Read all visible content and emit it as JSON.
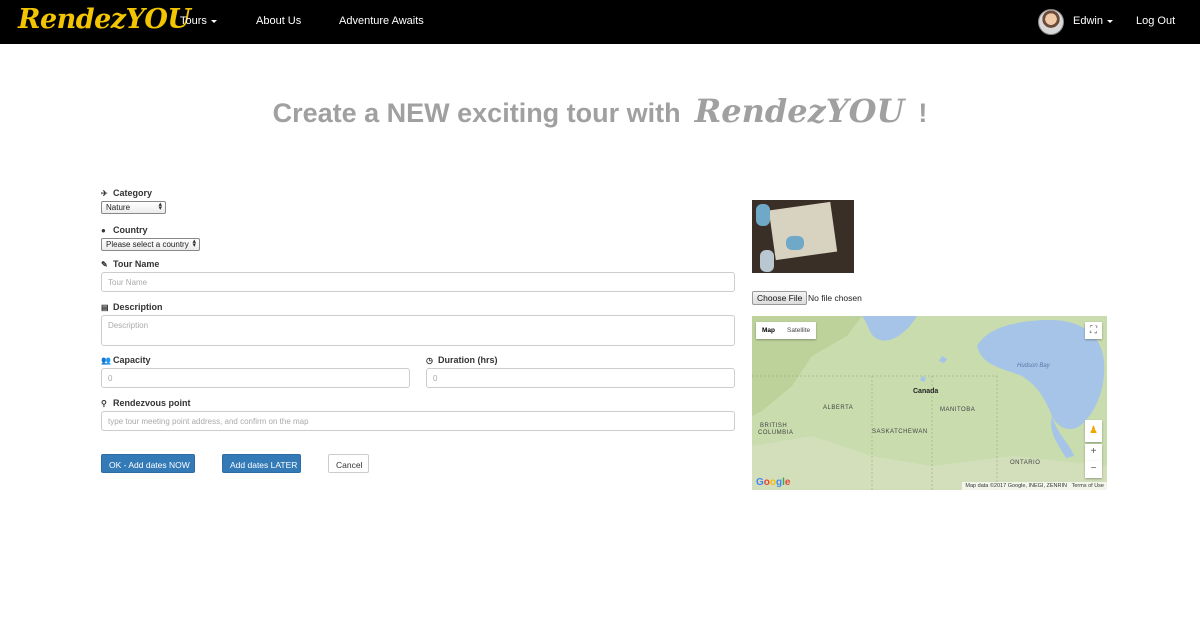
{
  "navbar": {
    "brand": "RendezYOU",
    "tours": "Tours",
    "about": "About Us",
    "adventure": "Adventure Awaits",
    "user": "Edwin",
    "logout": "Log Out"
  },
  "headline": {
    "prefix": "Create a NEW exciting tour with",
    "logo": "RendezYOU",
    "suffix": "!"
  },
  "form": {
    "category": {
      "label": "Category",
      "value": "Nature"
    },
    "country": {
      "label": "Country",
      "value": "Please select a country"
    },
    "tour_name": {
      "label": "Tour Name",
      "placeholder": "Tour Name"
    },
    "description": {
      "label": "Description",
      "placeholder": "Description"
    },
    "capacity": {
      "label": "Capacity",
      "value": "0"
    },
    "duration": {
      "label": "Duration (hrs)",
      "value": "0"
    },
    "rendezvous": {
      "label": "Rendezvous point",
      "placeholder": "type tour meeting point address, and confirm on the map"
    },
    "buttons": {
      "add_now": "OK - Add dates NOW",
      "add_later": "Add dates LATER",
      "cancel": "Cancel"
    }
  },
  "file": {
    "button": "Choose File",
    "status": "No file chosen"
  },
  "map": {
    "type_map": "Map",
    "type_satellite": "Satellite",
    "labels": {
      "canada": "Canada",
      "hudson": "Hudson Bay",
      "alberta": "ALBERTA",
      "manitoba": "MANITOBA",
      "bc1": "BRITISH",
      "bc2": "COLUMBIA",
      "sask": "SASKATCHEWAN",
      "ontario": "ONTARIO"
    },
    "attribution": "Map data ©2017 Google, INEGI, ZENRIN",
    "terms": "Terms of Use",
    "google": "Google",
    "colors": {
      "land": "#c5d9a8",
      "water": "#a5c4e8",
      "accent": "#337ab7",
      "brand": "#f2c500"
    }
  }
}
